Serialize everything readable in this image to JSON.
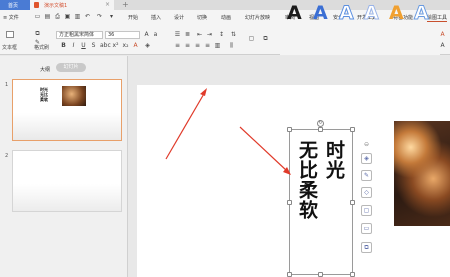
{
  "tabs": {
    "home": "首页",
    "doc": "演示文稿1",
    "plus": "+"
  },
  "menu": {
    "file": "≡ 文件",
    "items": [
      "开始",
      "插入",
      "设计",
      "切换",
      "动画",
      "幻灯片放映",
      "审阅",
      "视图",
      "安全",
      "开发工具",
      "特色功能",
      "绘图工具"
    ]
  },
  "toolbar": {
    "textbox": "文本框",
    "shape_fill": "格式刷",
    "font_name": "方正粗黑宋简体",
    "font_size": "36",
    "style_letter": "A"
  },
  "colors": {
    "accent": "#c8502e",
    "home_tab": "#4a7bd4",
    "wordart": [
      "#1a1a1a",
      "#3b6fd4",
      "#5b8fe0",
      "#9ab4e8",
      "#f0a030",
      "#6a9be0"
    ]
  },
  "left_panel": {
    "tab_outline": "大纲",
    "tab_slides": "幻灯片"
  },
  "slides": [
    {
      "number": "1",
      "thumb_title": "时光无比柔软"
    },
    {
      "number": "2"
    }
  ],
  "slide": {
    "line1": "时光",
    "line2": "无比柔软"
  }
}
